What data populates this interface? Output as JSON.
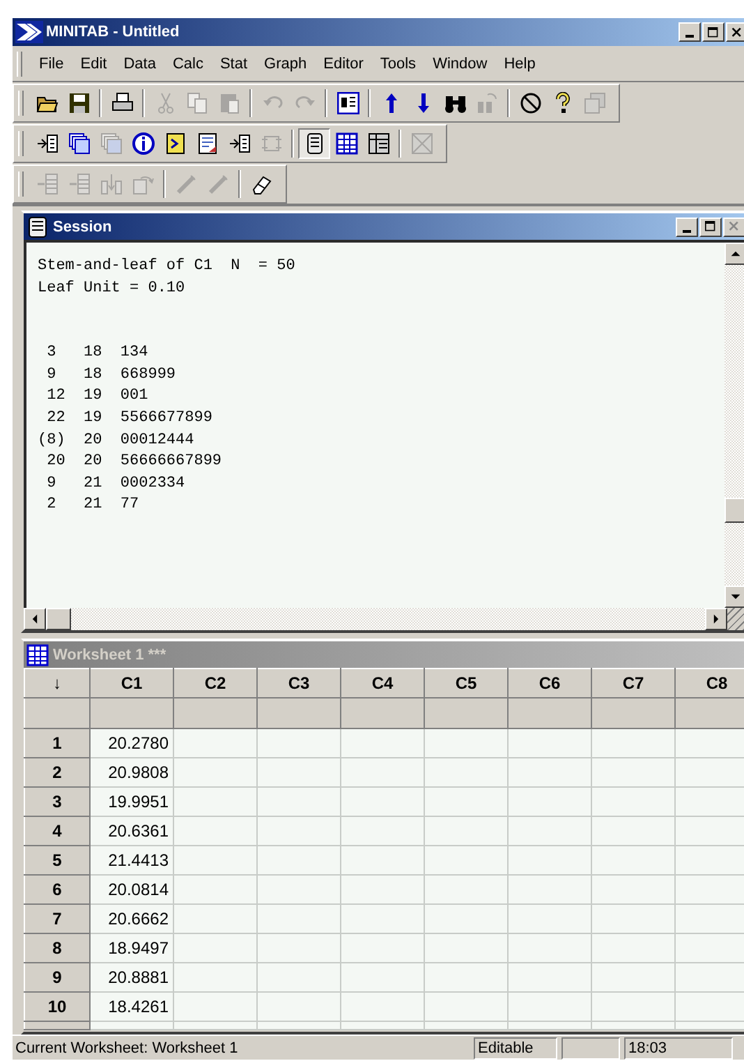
{
  "window": {
    "title": "MINITAB - Untitled"
  },
  "menu": [
    "File",
    "Edit",
    "Data",
    "Calc",
    "Stat",
    "Graph",
    "Editor",
    "Tools",
    "Window",
    "Help"
  ],
  "toolbars": [
    {
      "groups": [
        {
          "buttons": [
            {
              "disabled": false,
              "pressed": false
            },
            {
              "disabled": false,
              "pressed": false
            }
          ]
        },
        {
          "buttons": [
            {
              "disabled": false,
              "pressed": false
            }
          ]
        },
        {
          "buttons": [
            {
              "disabled": true,
              "pressed": false
            },
            {
              "disabled": true,
              "pressed": false
            },
            {
              "disabled": true,
              "pressed": false
            }
          ]
        },
        {
          "buttons": [
            {
              "disabled": true,
              "pressed": false
            },
            {
              "disabled": true,
              "pressed": false
            }
          ]
        },
        {
          "buttons": [
            {
              "disabled": false,
              "pressed": false
            }
          ]
        },
        {
          "buttons": [
            {
              "disabled": false,
              "pressed": false
            },
            {
              "disabled": false,
              "pressed": false
            },
            {
              "disabled": false,
              "pressed": false
            },
            {
              "disabled": true,
              "pressed": false
            }
          ]
        },
        {
          "buttons": [
            {
              "disabled": false,
              "pressed": false
            },
            {
              "disabled": false,
              "pressed": false
            },
            {
              "disabled": true,
              "pressed": false
            }
          ]
        }
      ]
    },
    {
      "groups": [
        {
          "buttons": [
            {
              "disabled": false,
              "pressed": false
            },
            {
              "disabled": false,
              "pressed": false
            },
            {
              "disabled": true,
              "pressed": false
            },
            {
              "disabled": false,
              "pressed": false
            },
            {
              "disabled": false,
              "pressed": false
            },
            {
              "disabled": false,
              "pressed": false
            },
            {
              "disabled": false,
              "pressed": false
            },
            {
              "disabled": true,
              "pressed": false
            }
          ]
        },
        {
          "buttons": [
            {
              "disabled": false,
              "pressed": true
            },
            {
              "disabled": false,
              "pressed": false
            },
            {
              "disabled": false,
              "pressed": false
            }
          ]
        },
        {
          "buttons": [
            {
              "disabled": true,
              "pressed": false
            }
          ]
        }
      ]
    },
    {
      "groups": [
        {
          "buttons": [
            {
              "disabled": true,
              "pressed": false
            },
            {
              "disabled": true,
              "pressed": false
            },
            {
              "disabled": true,
              "pressed": false
            },
            {
              "disabled": true,
              "pressed": false
            }
          ]
        },
        {
          "buttons": [
            {
              "disabled": true,
              "pressed": false
            },
            {
              "disabled": true,
              "pressed": false
            }
          ]
        },
        {
          "buttons": [
            {
              "disabled": false,
              "pressed": false
            }
          ]
        }
      ]
    }
  ],
  "session": {
    "title": "Session",
    "active": true,
    "header_lines": [
      "Stem-and-leaf of C1  N  = 50",
      "Leaf Unit = 0.10"
    ],
    "lines": [
      " 3   18  134",
      " 9   18  668999",
      " 12  19  001",
      " 22  19  5566677899",
      "(8)  20  00012444",
      " 20  20  56666667899",
      " 9   21  0002334",
      " 2   21  77"
    ]
  },
  "worksheet": {
    "title": "Worksheet 1 ***",
    "active": false,
    "corner": "↓",
    "columns": [
      "C1",
      "C2",
      "C3",
      "C4",
      "C5",
      "C6",
      "C7",
      "C8"
    ],
    "rows": [
      {
        "number": "1",
        "c1": "20.2780"
      },
      {
        "number": "2",
        "c1": "20.9808"
      },
      {
        "number": "3",
        "c1": "19.9951"
      },
      {
        "number": "4",
        "c1": "20.6361"
      },
      {
        "number": "5",
        "c1": "21.4413"
      },
      {
        "number": "6",
        "c1": "20.0814"
      },
      {
        "number": "7",
        "c1": "20.6662"
      },
      {
        "number": "8",
        "c1": "18.9497"
      },
      {
        "number": "9",
        "c1": "20.8881"
      },
      {
        "number": "10",
        "c1": "18.4261"
      }
    ]
  },
  "status_bar": {
    "message": "Current Worksheet: Worksheet 1",
    "mode": "Editable",
    "time": "18:03"
  }
}
